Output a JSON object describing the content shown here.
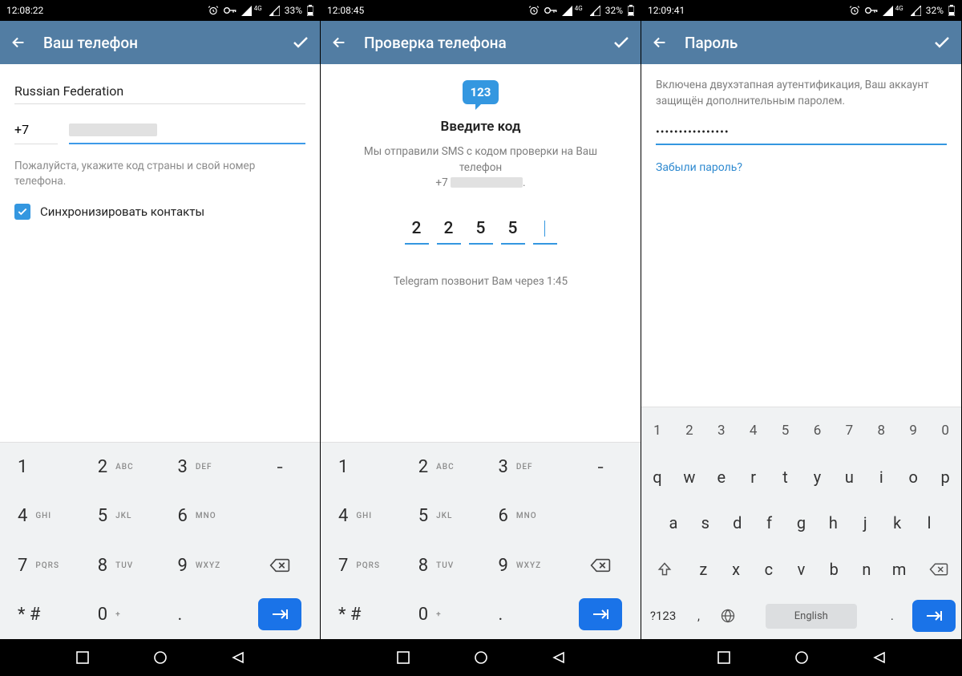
{
  "status": {
    "time1": "12:08:22",
    "time2": "12:08:45",
    "time3": "12:09:41",
    "net_label": "4G",
    "battery1": "33%",
    "battery2": "32%",
    "battery3": "32%"
  },
  "screen1": {
    "title": "Ваш телефон",
    "country": "Russian Federation",
    "country_code": "+7",
    "hint": "Пожалуйста, укажите код страны и свой номер телефона.",
    "sync_label": "Синхронизировать контакты"
  },
  "screen2": {
    "title": "Проверка телефона",
    "bubble": "123",
    "enter_code": "Введите код",
    "sms_line1": "Мы отправили SMS с кодом проверки на Ваш телефон",
    "sms_phone_prefix": "+7",
    "digits": [
      "2",
      "2",
      "5",
      "5",
      ""
    ],
    "call_text": "Telegram позвонит Вам через 1:45"
  },
  "screen3": {
    "title": "Пароль",
    "twofa": "Включена двухэтапная аутентификация, Ваш аккаунт защищён дополнительным паролем.",
    "password_mask": "••••••••••••••••",
    "forgot": "Забыли пароль?"
  },
  "numpad": {
    "k1": "1",
    "k2": "2",
    "k3": "3",
    "k4": "4",
    "k5": "5",
    "k6": "6",
    "k7": "7",
    "k8": "8",
    "k9": "9",
    "k0": "0",
    "abc": "ABC",
    "def": "DEF",
    "ghi": "GHI",
    "jkl": "JKL",
    "mno": "MNO",
    "pqrs": "PQRS",
    "tuv": "TUV",
    "wxyz": "WXYZ",
    "star": "* #",
    "plus": "+",
    "dot": ".",
    "dash": "-"
  },
  "qwerty": {
    "nums": [
      "1",
      "2",
      "3",
      "4",
      "5",
      "6",
      "7",
      "8",
      "9",
      "0"
    ],
    "row1": [
      "q",
      "w",
      "e",
      "r",
      "t",
      "y",
      "u",
      "i",
      "o",
      "p"
    ],
    "row2": [
      "a",
      "s",
      "d",
      "f",
      "g",
      "h",
      "j",
      "k",
      "l"
    ],
    "row3": [
      "z",
      "x",
      "c",
      "v",
      "b",
      "n",
      "m"
    ],
    "sym": "?123",
    "comma": ",",
    "lang": "English",
    "dot": "."
  }
}
